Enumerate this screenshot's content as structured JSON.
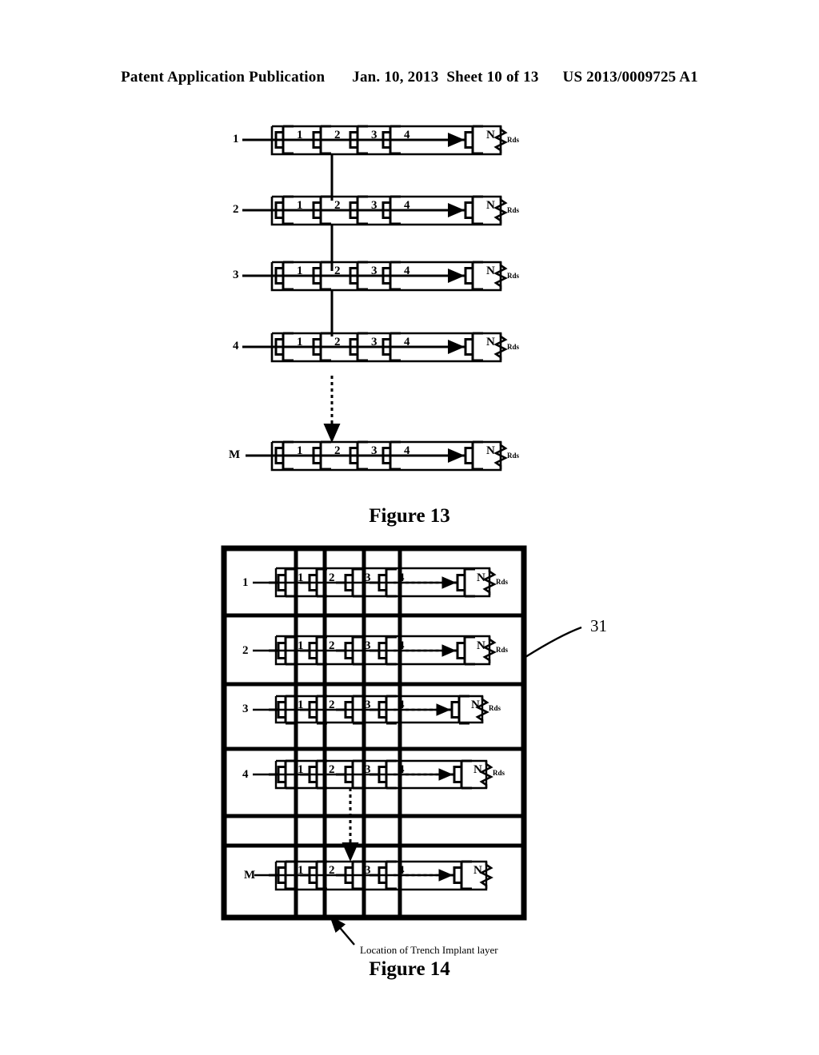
{
  "header": {
    "publication": "Patent Application Publication",
    "date": "Jan. 10, 2013",
    "sheet": "Sheet 10 of 13",
    "docnum": "US 2013/0009725 A1"
  },
  "figures": [
    {
      "id": "figure-13",
      "caption": "Figure 13",
      "row_labels": [
        "1",
        "2",
        "3",
        "4",
        "M"
      ],
      "transistor_labels": [
        "1",
        "2",
        "3",
        "4",
        "N"
      ],
      "resistor_label": "Rds",
      "ellipsis_arrow": "dashed-arrow-right",
      "vertical_connectors": 3,
      "vertical_dashed_arrow": "dashed-arrow-down"
    },
    {
      "id": "figure-14",
      "caption": "Figure 14",
      "row_labels": [
        "1",
        "2",
        "3",
        "4",
        "M"
      ],
      "transistor_labels": [
        "1",
        "2",
        "3",
        "4",
        "N"
      ],
      "resistor_label": "Rds",
      "reference_numeral": "31",
      "annotation": "Location of Trench Implant layer",
      "ellipsis_arrow": "dashed-arrow-right",
      "vertical_dashed_arrow": "dashed-arrow-down",
      "grid": {
        "columns": 5,
        "rows": 6,
        "empty_row_index": 4
      }
    }
  ],
  "colors": {
    "ink": "#000000",
    "paper": "#ffffff"
  }
}
